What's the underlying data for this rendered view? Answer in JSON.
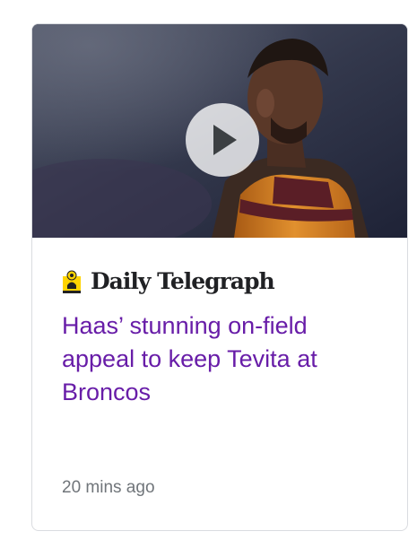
{
  "card": {
    "source": {
      "name": "Daily Telegraph",
      "logo_icon": "daily-telegraph-crest-icon",
      "brand_color": "#ffd400"
    },
    "headline": "Haas’ stunning on-field appeal to keep Tevita at Broncos",
    "timestamp": "20 mins ago",
    "video": {
      "play_icon": "play-icon"
    },
    "colors": {
      "headline_visited": "#681da8",
      "timestamp": "#70757a",
      "border": "#dadce0"
    }
  }
}
